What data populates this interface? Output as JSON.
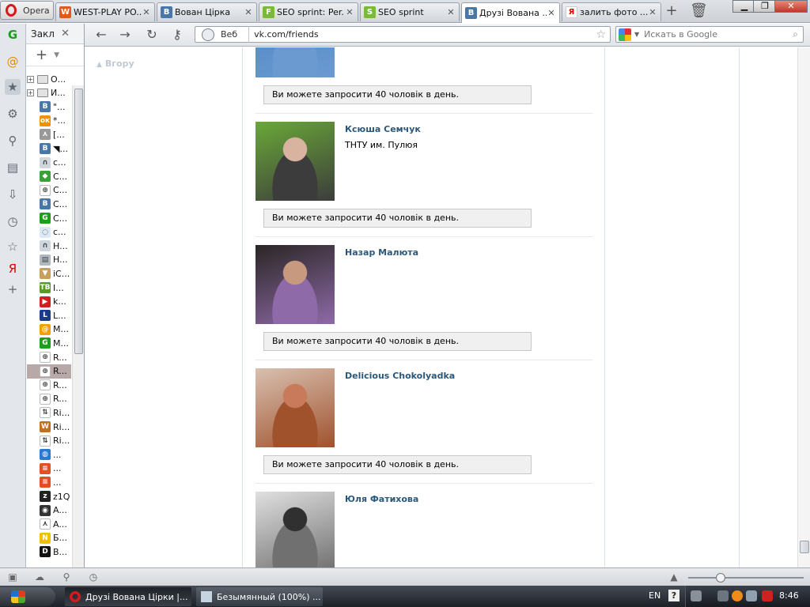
{
  "browser": {
    "menu_label": "Opera",
    "tabs": [
      {
        "title": "WEST-PLAY PO...",
        "favicon": "wp-icon",
        "color": "#e25a1b",
        "glyph": "W",
        "active": false
      },
      {
        "title": "Вован Цірка",
        "favicon": "vk-icon",
        "color": "#4a76a8",
        "glyph": "B",
        "active": false
      },
      {
        "title": "SEO sprint: Per...",
        "favicon": "seosprint-icon",
        "color": "#7ab93c",
        "glyph": "F",
        "active": false
      },
      {
        "title": "SEO sprint",
        "favicon": "seosprint-icon",
        "color": "#7ab93c",
        "glyph": "S",
        "active": false
      },
      {
        "title": "Друзі Вована ...",
        "favicon": "vk-icon",
        "color": "#4a76a8",
        "glyph": "B",
        "active": true
      },
      {
        "title": "залить фото ...",
        "favicon": "yandex-icon",
        "color": "#ffffff",
        "glyph": "Я",
        "active": false
      }
    ],
    "tab_close": "✕",
    "window_controls": {
      "minimize": "▁",
      "maximize": "❐",
      "close": "✕"
    }
  },
  "panel": {
    "title": "Закл",
    "close": "✕",
    "strip_icons": [
      "cashback-icon",
      "mail-icon",
      "bookmarks-icon",
      "settings-icon",
      "unite-icon",
      "notes-icon",
      "downloads-icon",
      "history-icon",
      "bookmarks-panel-icon",
      "yandex-icon",
      "add-panel-icon"
    ],
    "bookmarks": [
      {
        "text": "О...",
        "type": "folder",
        "icon": "folder-icon"
      },
      {
        "text": "И...",
        "type": "folder",
        "icon": "folder-icon"
      },
      {
        "text": "\"...",
        "icon": "vk-icon",
        "color": "#4a76a8",
        "glyph": "B"
      },
      {
        "text": "*...",
        "icon": "odnoklassniki-icon",
        "color": "#f29000",
        "glyph": "ок"
      },
      {
        "text": "[...",
        "icon": "person-icon",
        "color": "#999999",
        "glyph": "⋏"
      },
      {
        "text": "◥...",
        "icon": "vk-icon",
        "color": "#4a76a8",
        "glyph": "B"
      },
      {
        "text": "c...",
        "icon": "ghost-icon",
        "color": "#cfd6dd",
        "glyph": "∩"
      },
      {
        "text": "C...",
        "icon": "leaf-icon",
        "color": "#3aa03a",
        "glyph": "◆"
      },
      {
        "text": "C...",
        "icon": "target-icon",
        "color": "#ffffff",
        "glyph": "⊕"
      },
      {
        "text": "C...",
        "icon": "vk-icon",
        "color": "#4a76a8",
        "glyph": "B"
      },
      {
        "text": "C...",
        "icon": "cashback-icon",
        "color": "#1aa01a",
        "glyph": "G"
      },
      {
        "text": "c...",
        "icon": "pin-icon",
        "color": "#dce8f4",
        "glyph": "◌"
      },
      {
        "text": "H...",
        "icon": "ghost-icon",
        "color": "#cfd6dd",
        "glyph": "∩"
      },
      {
        "text": "H...",
        "icon": "chart-icon",
        "color": "#b0b8c0",
        "glyph": "▤"
      },
      {
        "text": "iC...",
        "icon": "icecream-icon",
        "color": "#c7a15a",
        "glyph": "▼"
      },
      {
        "text": "I...",
        "icon": "tb-icon",
        "color": "#5a9a2a",
        "glyph": "TB"
      },
      {
        "text": "k...",
        "icon": "youtube-icon",
        "color": "#d02020",
        "glyph": "▶"
      },
      {
        "text": "L...",
        "icon": "l-icon",
        "color": "#1a3b8a",
        "glyph": "L"
      },
      {
        "text": "M...",
        "icon": "mail-icon",
        "color": "#f0a000",
        "glyph": "@"
      },
      {
        "text": "M...",
        "icon": "cashback-icon",
        "color": "#1aa01a",
        "glyph": "G"
      },
      {
        "text": "R...",
        "icon": "target-icon",
        "color": "#ffffff",
        "glyph": "⊕"
      },
      {
        "text": "R...",
        "icon": "target-icon",
        "color": "#ffffff",
        "glyph": "⊕",
        "selected": true
      },
      {
        "text": "R...",
        "icon": "target-icon",
        "color": "#ffffff",
        "glyph": "⊕"
      },
      {
        "text": "R...",
        "icon": "target-icon",
        "color": "#ffffff",
        "glyph": "⊕"
      },
      {
        "text": "Ri...",
        "icon": "arrows-icon",
        "color": "#ffffff",
        "glyph": "⇅"
      },
      {
        "text": "Ri...",
        "icon": "w-icon",
        "color": "#c07020",
        "glyph": "W"
      },
      {
        "text": "Ri...",
        "icon": "arrows-icon",
        "color": "#ffffff",
        "glyph": "⇅"
      },
      {
        "text": "...",
        "icon": "globe-icon",
        "color": "#2a7ad0",
        "glyph": "◍"
      },
      {
        "text": "...",
        "icon": "stripes-icon",
        "color": "#e05020",
        "glyph": "≡"
      },
      {
        "text": "...",
        "icon": "stripes-icon",
        "color": "#e05020",
        "glyph": "≡"
      },
      {
        "text": "z1Q",
        "icon": "z-icon",
        "color": "#222222",
        "glyph": "z"
      },
      {
        "text": "A...",
        "icon": "ball-icon",
        "color": "#333333",
        "glyph": "◉"
      },
      {
        "text": "A...",
        "icon": "runner-icon",
        "color": "#ffffff",
        "glyph": "⋏"
      },
      {
        "text": "Б...",
        "icon": "n-icon",
        "color": "#f0c000",
        "glyph": "N"
      },
      {
        "text": "В...",
        "icon": "d-icon",
        "color": "#111111",
        "glyph": "D"
      }
    ]
  },
  "navbar": {
    "back": "←",
    "forward": "→",
    "reload": "↻",
    "key": "⚷",
    "url_prefix": "Веб",
    "url": "vk.com/friends",
    "search_placeholder": "Искать в Google"
  },
  "page": {
    "back_to_top": "Вгору",
    "request_text": "Ви можете запросити 40 чоловік в день.",
    "friends": [
      {
        "name": "",
        "sub": "",
        "photo_colors": [
          "#4f86c4",
          "#6a9ad0",
          "#7a5aa8"
        ],
        "partial": true
      },
      {
        "name": "Ксюша Семчук",
        "sub": "ТНТУ им. Пулюя",
        "photo_colors": [
          "#6aa838",
          "#3c3c3c",
          "#d8b4a0"
        ]
      },
      {
        "name": "Назар Малюта",
        "sub": "",
        "photo_colors": [
          "#2a2624",
          "#8e6aa8",
          "#c79a80"
        ]
      },
      {
        "name": "Delicious Chokolyadka",
        "sub": "",
        "photo_colors": [
          "#d8c0b0",
          "#a0522d",
          "#c87a5a"
        ]
      },
      {
        "name": "Юля Фатихова",
        "sub": "",
        "photo_colors": [
          "#e0e0e0",
          "#707070",
          "#303030"
        ]
      }
    ]
  },
  "taskbar": {
    "tasks": [
      {
        "label": "Друзі Вована Цірки |...",
        "icon": "opera-icon",
        "active": true
      },
      {
        "label": "Безымянный (100%) ...",
        "icon": "paint-icon",
        "active": false
      }
    ],
    "lang": "EN",
    "help": "?",
    "clock": "8:46"
  }
}
